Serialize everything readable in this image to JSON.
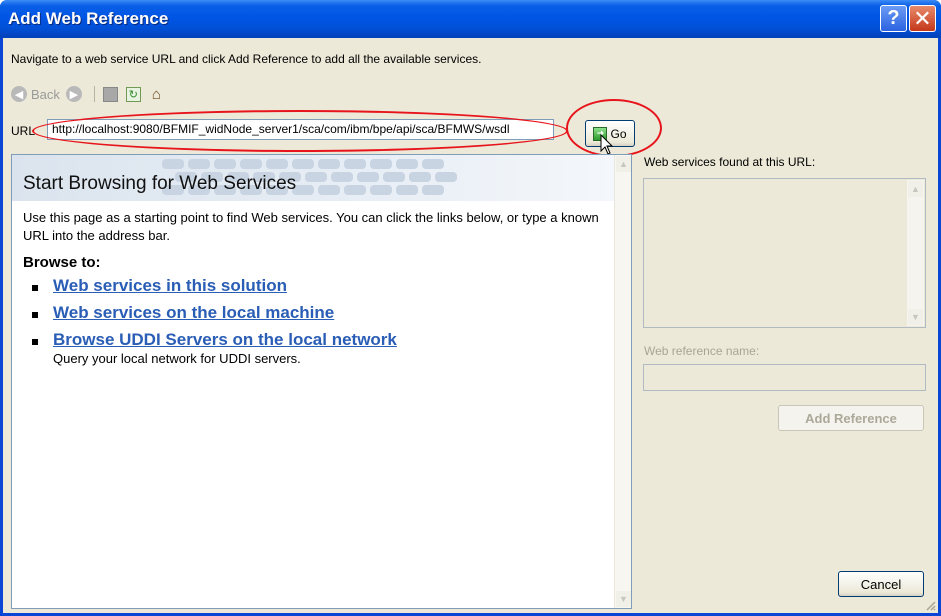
{
  "window": {
    "title": "Add Web Reference",
    "help_icon": "question-mark-icon",
    "close_icon": "close-x-icon",
    "help_glyph": "?",
    "close_glyph": "✕"
  },
  "instruction": "Navigate to a web service URL and click Add Reference to add all the available services.",
  "toolbar": {
    "back_label": "Back",
    "back_icon": "back-arrow-icon",
    "forward_icon": "forward-arrow-icon",
    "stop_icon": "stop-icon",
    "refresh_icon": "refresh-icon",
    "home_icon": "home-icon"
  },
  "url": {
    "label": "URL",
    "value": "http://localhost:9080/BFMIF_widNode_server1/sca/com/ibm/bpe/api/sca/BFMWS/wsdl",
    "go_label": "Go",
    "go_icon": "go-arrow-icon"
  },
  "annotations": {
    "highlight_color": "#e8141c"
  },
  "browser": {
    "heading": "Start Browsing for Web Services",
    "intro": "Use this page as a starting point to find Web services. You can click the links below, or type a known URL into the address bar.",
    "browse_heading": "Browse to:",
    "links": [
      {
        "label": "Web services in this solution",
        "description": ""
      },
      {
        "label": "Web services on the local machine",
        "description": ""
      },
      {
        "label": "Browse UDDI Servers on the local network",
        "description": "Query your local network for UDDI servers."
      }
    ],
    "link_color": "#2a5db5"
  },
  "side_panel": {
    "found_label": "Web services found at this URL:",
    "refname_label": "Web reference name:",
    "refname_value": "",
    "add_reference_label": "Add Reference"
  },
  "footer": {
    "cancel_label": "Cancel"
  },
  "colors": {
    "titlebar": "#0055e5",
    "dialog_bg": "#ece9d8",
    "field_border": "#7f9db9"
  }
}
